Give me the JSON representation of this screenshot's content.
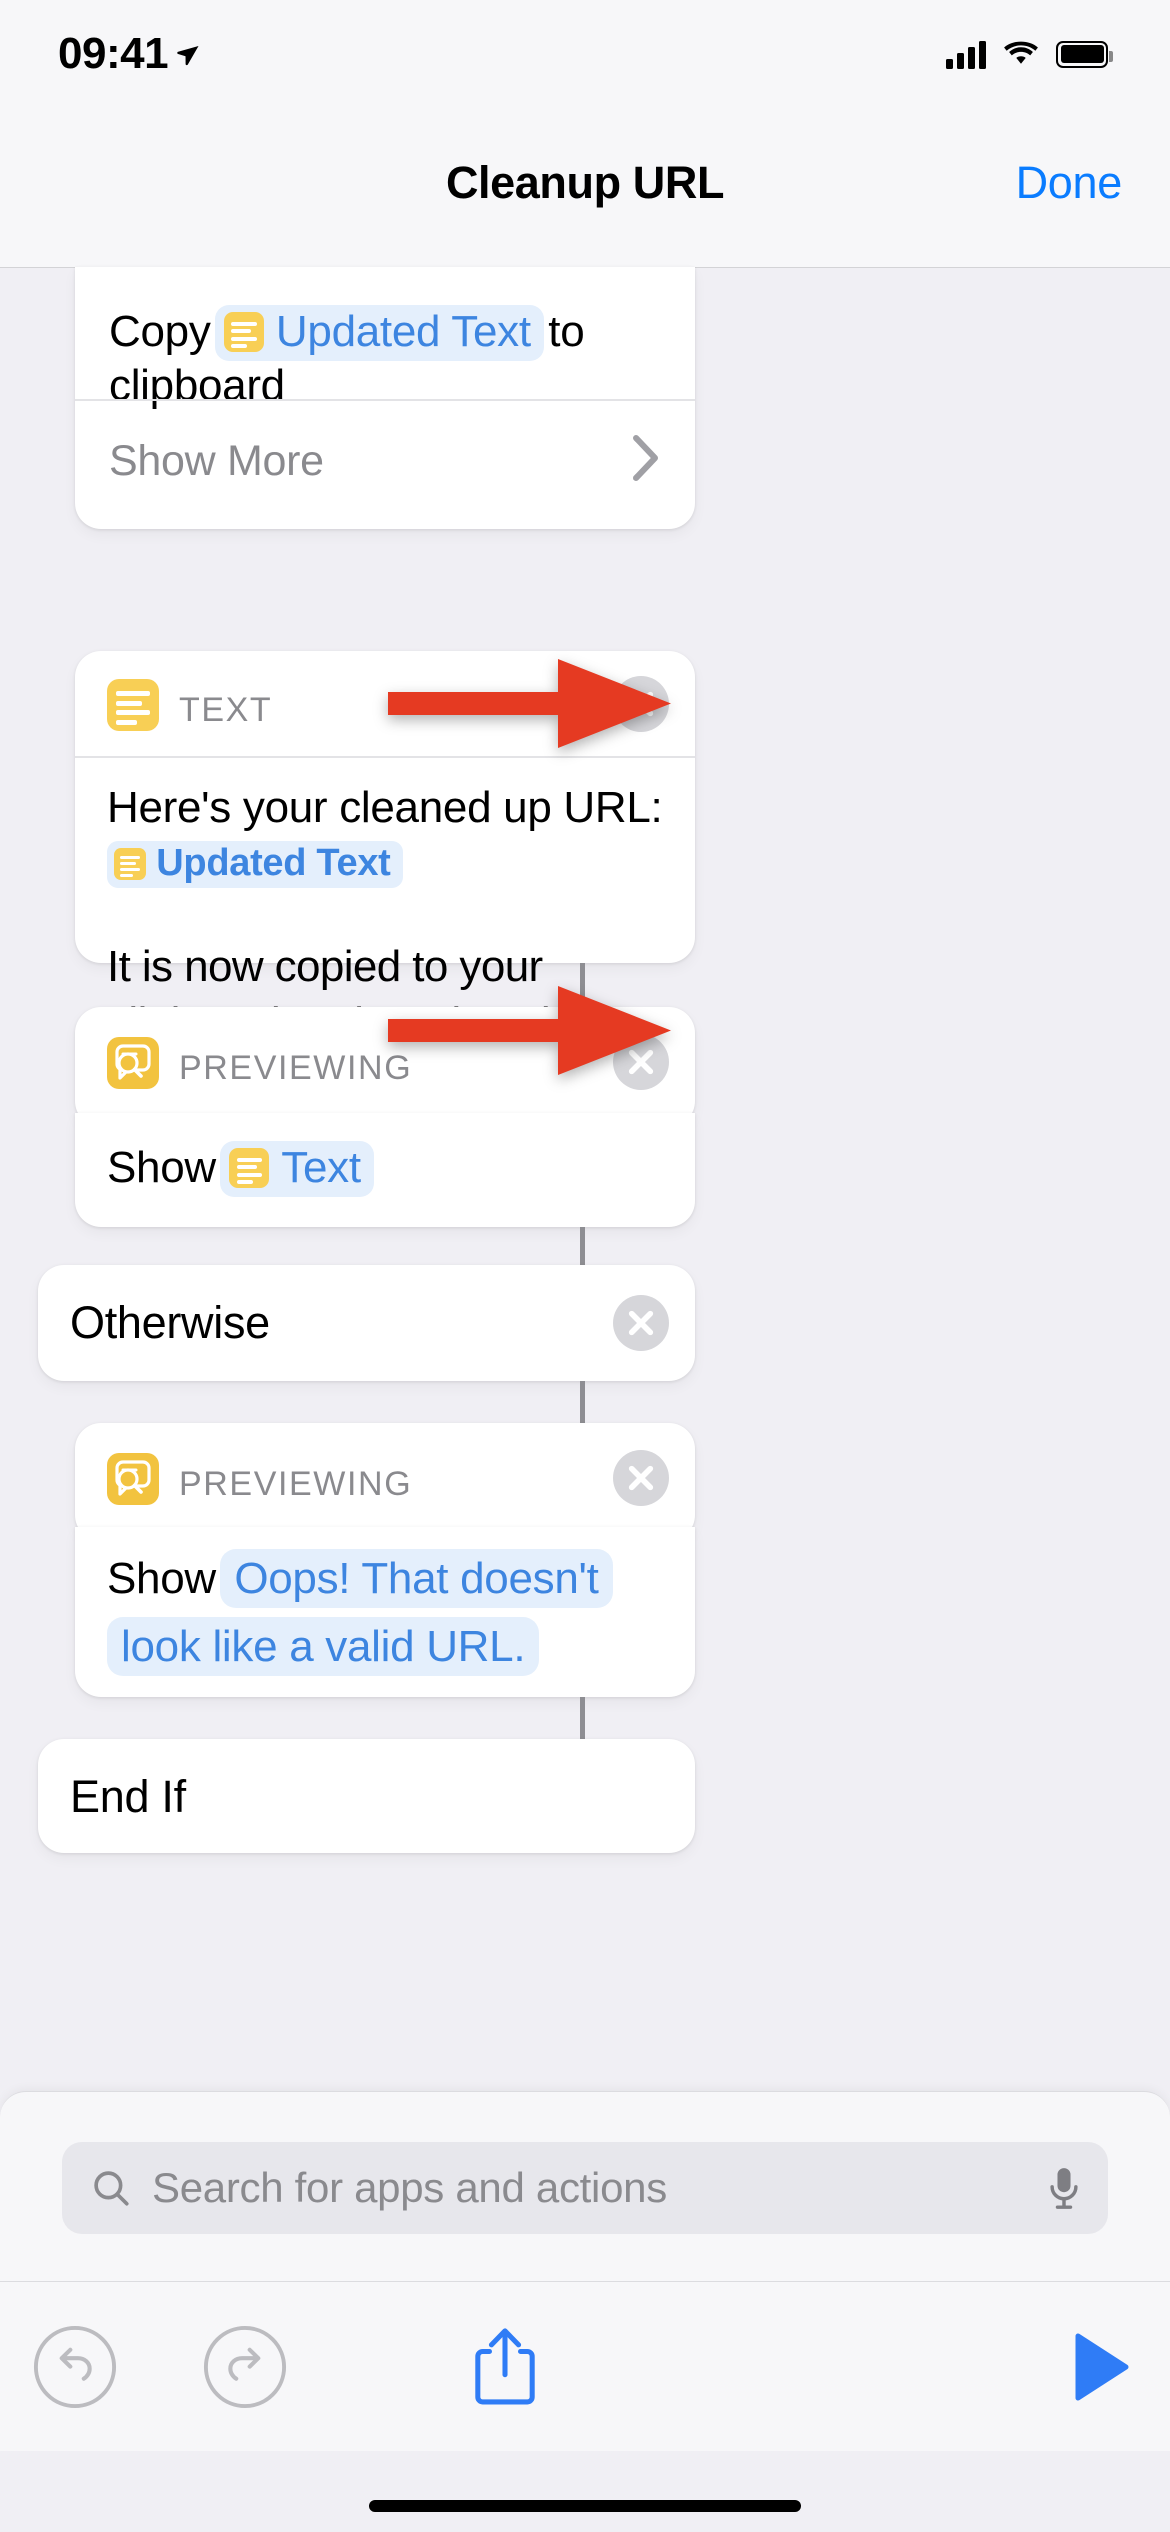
{
  "status_bar": {
    "time": "09:41",
    "location_icon": "location-arrow-icon",
    "signal_icon": "cellular-signal-icon",
    "wifi_icon": "wifi-icon",
    "battery_icon": "battery-full-icon"
  },
  "nav": {
    "title": "Cleanup URL",
    "done_label": "Done"
  },
  "actions": {
    "copy_card": {
      "prefix": "Copy",
      "token": "Updated Text",
      "suffix": "to clipboard",
      "show_more_label": "Show More",
      "chevron_icon": "chevron-right-icon"
    },
    "text_card": {
      "header_label": "TEXT",
      "header_icon": "text-document-icon",
      "close_icon": "close-circle-icon",
      "body_line1": "Here's your cleaned up URL:",
      "body_token": "Updated Text",
      "body_line2": "It is now copied to your clipboard and ready to be pasted anywhere."
    },
    "preview_card_1": {
      "header_label": "PREVIEWING",
      "header_icon": "quicklook-preview-icon",
      "close_icon": "close-circle-icon",
      "prefix": "Show",
      "token": "Text"
    },
    "otherwise_card": {
      "label": "Otherwise",
      "close_icon": "close-circle-icon"
    },
    "preview_card_2": {
      "header_label": "PREVIEWING",
      "header_icon": "quicklook-preview-icon",
      "close_icon": "close-circle-icon",
      "prefix": "Show",
      "token": "Oops! That doesn't look like a valid URL."
    },
    "end_if_card": {
      "label": "End If"
    }
  },
  "annotations": {
    "arrow_1": "red-arrow-right",
    "arrow_2": "red-arrow-right",
    "arrow_color": "#e53a22"
  },
  "search": {
    "placeholder": "Search for apps and actions",
    "search_icon": "search-icon",
    "mic_icon": "microphone-icon"
  },
  "toolbar": {
    "undo_icon": "undo-icon",
    "redo_icon": "redo-icon",
    "share_icon": "share-icon",
    "play_icon": "play-icon",
    "accent_color": "#2f7cf6",
    "disabled_color": "#bcbcc0"
  },
  "home_indicator": "home-indicator"
}
